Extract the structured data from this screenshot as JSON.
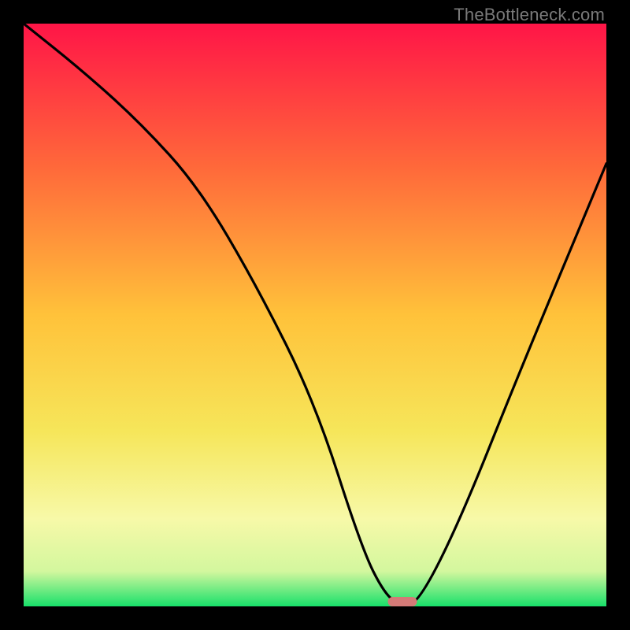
{
  "watermark": "TheBottleneck.com",
  "chart_data": {
    "type": "line",
    "title": "",
    "xlabel": "",
    "ylabel": "",
    "xlim": [
      0,
      100
    ],
    "ylim": [
      0,
      100
    ],
    "grid": false,
    "legend": false,
    "x": [
      0,
      10,
      20,
      30,
      40,
      50,
      58,
      62,
      65,
      68,
      75,
      85,
      100
    ],
    "values": [
      100,
      92,
      83,
      72,
      55,
      35,
      10,
      2,
      0,
      1,
      15,
      40,
      76
    ],
    "notes": "V-shaped bottleneck curve; minimum at ~x=65 (optimal match)",
    "marker": {
      "x": 65,
      "y": 0,
      "width": 5,
      "color": "#d47a77"
    },
    "background_gradient": {
      "stops": [
        {
          "y_pct": 0,
          "color": "#ff1547"
        },
        {
          "y_pct": 25,
          "color": "#ff6a3a"
        },
        {
          "y_pct": 50,
          "color": "#ffc23a"
        },
        {
          "y_pct": 70,
          "color": "#f6e65a"
        },
        {
          "y_pct": 85,
          "color": "#f7f9a8"
        },
        {
          "y_pct": 94,
          "color": "#d3f79e"
        },
        {
          "y_pct": 100,
          "color": "#18e06a"
        }
      ]
    }
  }
}
